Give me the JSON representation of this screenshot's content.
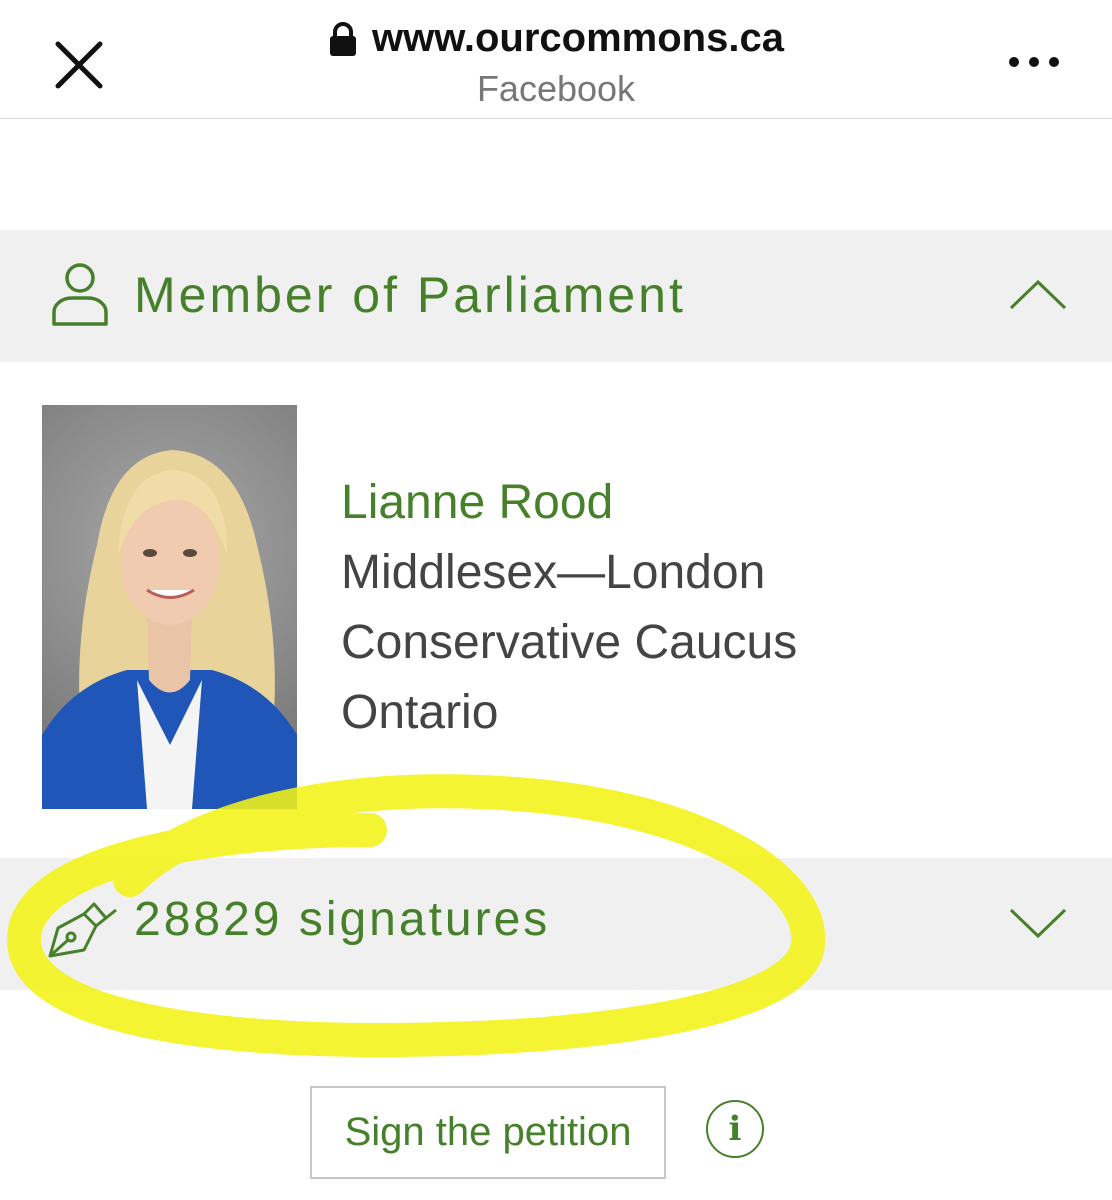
{
  "browser": {
    "url": "www.ourcommons.ca",
    "site_name": "Facebook",
    "icons": {
      "close": "close-icon",
      "lock": "lock-icon",
      "more": "more-dots-icon"
    }
  },
  "mp_section": {
    "title": "Member of Parliament",
    "icon": "person-icon",
    "toggle_icon": "chevron-up-icon",
    "expanded": true,
    "member": {
      "name": "Lianne Rood",
      "riding": "Middlesex—London",
      "caucus": "Conservative Caucus",
      "province": "Ontario"
    }
  },
  "signatures_section": {
    "label": "28829 signatures",
    "icon": "pen-nib-icon",
    "toggle_icon": "chevron-down-icon",
    "expanded": false
  },
  "actions": {
    "sign_label": "Sign the petition",
    "info_symbol": "i"
  },
  "colors": {
    "accent_green": "#46802a",
    "header_bg": "#f0f0f0",
    "highlight_yellow": "#f2f216"
  }
}
